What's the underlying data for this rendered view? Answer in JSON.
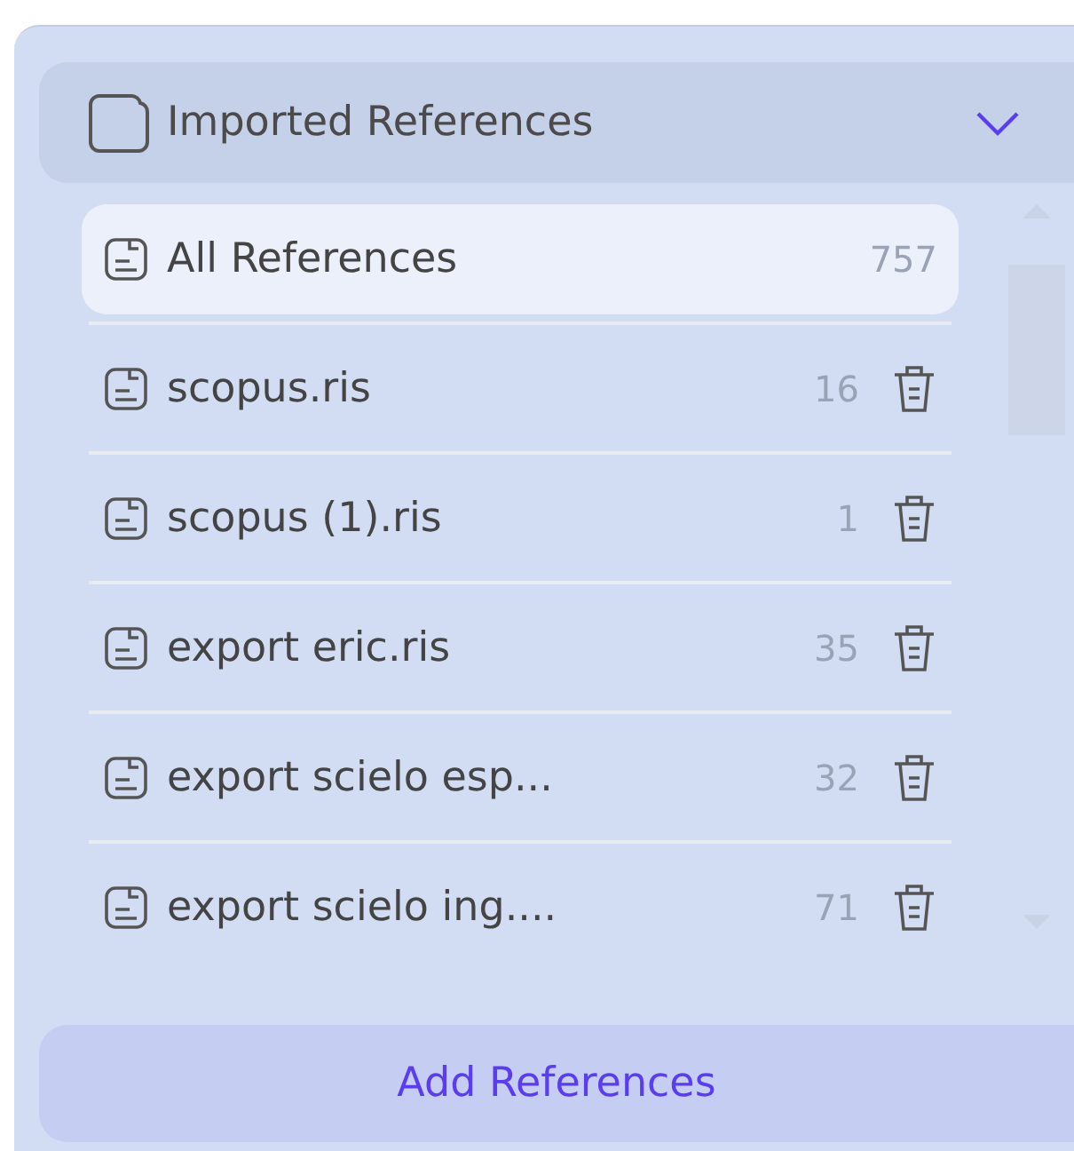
{
  "section": {
    "title": "Imported References",
    "expanded": true
  },
  "items": [
    {
      "kind": "all",
      "name": "All References",
      "count": "757",
      "selected": true
    },
    {
      "kind": "file",
      "name": "scopus.ris",
      "count": "16",
      "selected": false
    },
    {
      "kind": "file",
      "name": "scopus (1).ris",
      "count": "1",
      "selected": false
    },
    {
      "kind": "file",
      "name": "export eric.ris",
      "count": "35",
      "selected": false
    },
    {
      "kind": "file",
      "name": "export scielo esp...",
      "count": "32",
      "selected": false
    },
    {
      "kind": "file",
      "name": "export scielo ing....",
      "count": "71",
      "selected": false
    }
  ],
  "add_button": "Add References"
}
